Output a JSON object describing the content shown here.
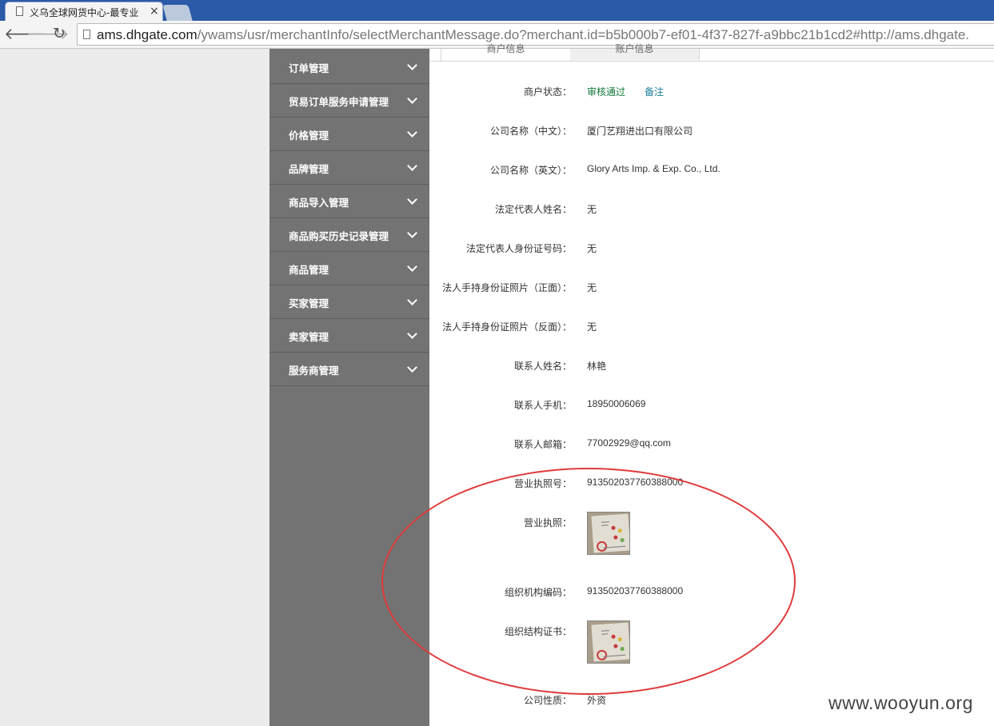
{
  "browser": {
    "tab_title": "义乌全球网货中心-最专业",
    "tab_close": "×",
    "url_host": "ams.dhgate.com",
    "url_path": "/ywams/usr/merchantInfo/selectMerchantMessage.do?merchant.id=b5b000b7-ef01-4f37-827f-a9bbc21b1cd2#http://ams.dhgate.",
    "back_glyph": "🡐",
    "forward_glyph": "🡒",
    "reload_glyph": "↻"
  },
  "sidebar": {
    "items": [
      {
        "label": "订单管理"
      },
      {
        "label": "贸易订单服务申请管理"
      },
      {
        "label": "价格管理"
      },
      {
        "label": "品牌管理"
      },
      {
        "label": "商品导入管理"
      },
      {
        "label": "商品购买历史记录管理"
      },
      {
        "label": "商品管理"
      },
      {
        "label": "买家管理"
      },
      {
        "label": "卖家管理"
      },
      {
        "label": "服务商管理"
      }
    ]
  },
  "content": {
    "tabs": [
      {
        "label": "商户信息"
      },
      {
        "label": "账户信息"
      }
    ],
    "fields": {
      "status": {
        "label": "商户状态：",
        "value": "审核通过",
        "note": "备注"
      },
      "name_cn": {
        "label": "公司名称（中文）：",
        "value": "厦门艺翔进出口有限公司"
      },
      "name_en": {
        "label": "公司名称（英文）：",
        "value": "Glory Arts Imp. & Exp. Co., Ltd."
      },
      "legal_name": {
        "label": "法定代表人姓名：",
        "value": "无"
      },
      "legal_id": {
        "label": "法定代表人身份证号码：",
        "value": "无"
      },
      "id_front": {
        "label": "法人手持身份证照片（正面）：",
        "value": "无"
      },
      "id_back": {
        "label": "法人手持身份证照片（反面）：",
        "value": "无"
      },
      "contact_name": {
        "label": "联系人姓名：",
        "value": "林艳"
      },
      "contact_phone": {
        "label": "联系人手机：",
        "value": "18950006069"
      },
      "contact_email": {
        "label": "联系人邮箱：",
        "value": "77002929@qq.com"
      },
      "license_no": {
        "label": "营业执照号：",
        "value": "913502037760388000"
      },
      "license_img": {
        "label": "营业执照："
      },
      "org_code": {
        "label": "组织机构编码：",
        "value": "913502037760388000"
      },
      "org_cert": {
        "label": "组织结构证书："
      },
      "company_type": {
        "label": "公司性质：",
        "value": "外资"
      }
    }
  },
  "watermark": "www.wooyun.org",
  "colors": {
    "titlebar": "#2a5aa8",
    "sidebar": "#737373",
    "status_green": "#117a3a",
    "note_teal": "#1a7f9a",
    "annotation_red": "#e03a3a"
  }
}
